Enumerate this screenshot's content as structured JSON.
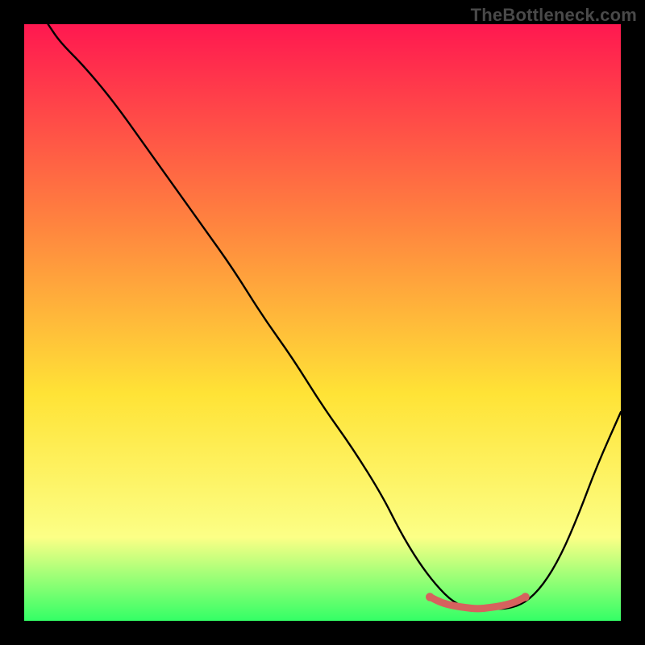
{
  "watermark": "TheBottleneck.com",
  "colors": {
    "bg": "#000000",
    "grad_top": "#ff1850",
    "grad_mid_high": "#ff823f",
    "grad_mid": "#ffe336",
    "grad_low": "#fcff86",
    "grad_bottom": "#33ff66",
    "curve": "#000000",
    "highlight": "#d6625e"
  },
  "chart_data": {
    "type": "line",
    "title": "",
    "xlabel": "",
    "ylabel": "",
    "xlim": [
      0,
      100
    ],
    "ylim": [
      0,
      100
    ],
    "series": [
      {
        "name": "bottleneck-curve",
        "x": [
          4,
          6,
          10,
          15,
          20,
          25,
          30,
          35,
          40,
          45,
          50,
          55,
          60,
          63,
          66,
          69,
          72,
          75,
          78,
          81,
          84,
          87,
          90,
          93,
          96,
          100
        ],
        "values": [
          100,
          97,
          93,
          87,
          80,
          73,
          66,
          59,
          51,
          44,
          36,
          29,
          21,
          15,
          10,
          6,
          3,
          2,
          2,
          2,
          3,
          6,
          11,
          18,
          26,
          35
        ]
      }
    ],
    "highlight_segment": {
      "name": "optimum-zone",
      "x": [
        68,
        70,
        72,
        74,
        76,
        78,
        80,
        82,
        84
      ],
      "values": [
        4,
        3,
        2.5,
        2.2,
        2,
        2.2,
        2.5,
        3,
        4
      ]
    }
  }
}
